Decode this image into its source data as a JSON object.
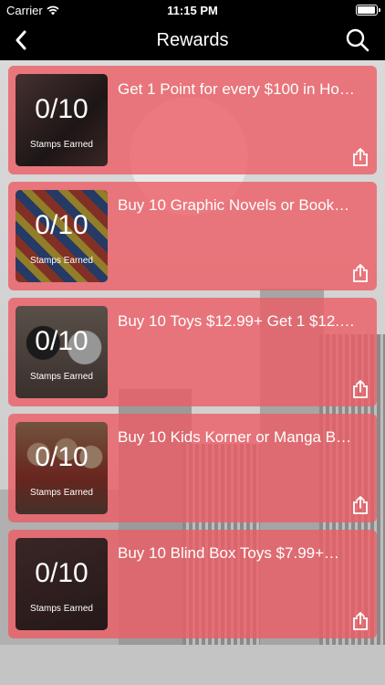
{
  "status_bar": {
    "carrier": "Carrier",
    "time": "11:15 PM"
  },
  "nav": {
    "title": "Rewards",
    "back_icon": "chevron-left-icon",
    "search_icon": "search-icon"
  },
  "rewards": [
    {
      "stamps": "0/10",
      "stamps_label": "Stamps Earned",
      "title": "Get 1 Point for every $100 in Ho…",
      "thumb_color": "#4a3a3a"
    },
    {
      "stamps": "0/10",
      "stamps_label": "Stamps Earned",
      "title": "Buy 10 Graphic Novels or Book…",
      "thumb_color": "#5a6a8a"
    },
    {
      "stamps": "0/10",
      "stamps_label": "Stamps Earned",
      "title": "Buy 10 Toys $12.99+ Get 1 $12.…",
      "thumb_color": "#6a5a5a"
    },
    {
      "stamps": "0/10",
      "stamps_label": "Stamps Earned",
      "title": "Buy 10 Kids Korner or Manga B…",
      "thumb_color": "#7a6a5a"
    },
    {
      "stamps": "0/10",
      "stamps_label": "Stamps Earned",
      "title": "Buy 10 Blind Box Toys $7.99+…",
      "thumb_color": "#5a4a4a"
    }
  ],
  "colors": {
    "card_overlay": "#ec5c64",
    "bar_background": "#000000"
  }
}
